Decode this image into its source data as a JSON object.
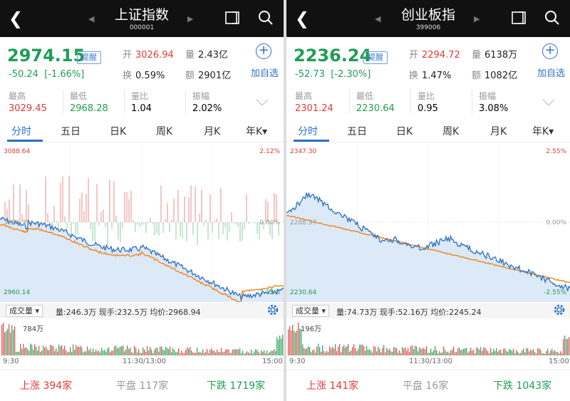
{
  "panels": [
    {
      "title": "上证指数",
      "code": "000001",
      "price": "2974.15",
      "change": "-50.24",
      "change_pct": "[-1.66%]",
      "remind_label": "提醒",
      "open_label": "开",
      "open": "3026.94",
      "volume_label": "量",
      "volume": "2.43亿",
      "turnover_label": "换",
      "turnover": "0.59%",
      "amount_label": "额",
      "amount": "2901亿",
      "add_label": "加自选",
      "high_label": "最高",
      "high": "3029.45",
      "low_label": "最低",
      "low": "2968.28",
      "ratio_label": "量比",
      "ratio": "1.04",
      "amp_label": "振幅",
      "amp": "2.02%",
      "tabs": [
        "分时",
        "五日",
        "日K",
        "周K",
        "月K",
        "年K▾"
      ],
      "chart_top_price": "3088.64",
      "chart_top_pct": "2.12%",
      "chart_mid_price": "3026.39",
      "chart_mid_pct": "0.00%",
      "chart_bottom_price": "2960.14",
      "chart_bottom_pct": "-2.12%",
      "vol_select": "成交量 ▾",
      "vol_info": "量:246.3万  现手:232.5万  均价:2968.94",
      "vol_scale": "784万",
      "time_start": "9:30",
      "time_mid": "11:30/13:00",
      "time_end": "15:00",
      "up_label": "上涨",
      "up_count": "394家",
      "flat_label": "平盘",
      "flat_count": "117家",
      "down_label": "下跌",
      "down_count": "1719家",
      "colors": {
        "up": "#e03a3a",
        "down": "#1f9d55",
        "accent": "#2d70cc",
        "avg_line": "#f08a24",
        "price_line": "#2a6fc0"
      }
    },
    {
      "title": "创业板指",
      "code": "399006",
      "price": "2236.24",
      "change": "-52.73",
      "change_pct": "[-2.30%]",
      "remind_label": "提醒",
      "open_label": "开",
      "open": "2294.72",
      "volume_label": "量",
      "volume": "6138万",
      "turnover_label": "换",
      "turnover": "1.47%",
      "amount_label": "额",
      "amount": "1082亿",
      "add_label": "加自选",
      "high_label": "最高",
      "high": "2301.24",
      "low_label": "最低",
      "low": "2230.64",
      "ratio_label": "量比",
      "ratio": "0.95",
      "amp_label": "振幅",
      "amp": "3.08%",
      "tabs": [
        "分时",
        "五日",
        "日K",
        "周K",
        "月K",
        "年K▾"
      ],
      "chart_top_price": "2347.30",
      "chart_top_pct": "2.55%",
      "chart_mid_price": "2288.97",
      "chart_mid_pct": "0.00%",
      "chart_bottom_price": "2230.64",
      "chart_bottom_pct": "-2.55%",
      "vol_select": "成交量 ▾",
      "vol_info": "量:74.73万  现手:52.16万  均价:2245.24",
      "vol_scale": "196万",
      "time_start": "9:30",
      "time_mid": "11:30/13:00",
      "time_end": "15:00",
      "up_label": "上涨",
      "up_count": "141家",
      "flat_label": "平盘",
      "flat_count": "16家",
      "down_label": "下跌",
      "down_count": "1043家",
      "colors": {
        "up": "#e03a3a",
        "down": "#1f9d55",
        "accent": "#2d70cc",
        "avg_line": "#f08a24",
        "price_line": "#2a6fc0"
      }
    }
  ]
}
